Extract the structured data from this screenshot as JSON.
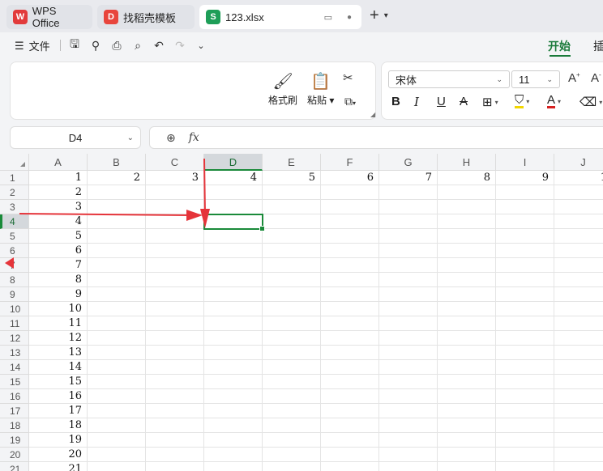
{
  "tabs": {
    "wps": {
      "label": "WPS Office",
      "icon": "W"
    },
    "daoke": {
      "label": "找稻壳模板",
      "icon": "D"
    },
    "file": {
      "label": "123.xlsx",
      "icon": "S"
    }
  },
  "menu": {
    "file_label": "文件",
    "ribbon_tab_active": "开始",
    "ribbon_tab_next": "插"
  },
  "ribbon": {
    "format_painter": "格式刷",
    "paste": "粘贴",
    "font_name": "宋体",
    "font_size": "11",
    "bold": "B",
    "italic": "I",
    "underline": "U",
    "strike": "A"
  },
  "formula_bar": {
    "cell_ref": "D4",
    "fx": "fx"
  },
  "colors": {
    "accent": "#1a8a3a",
    "arrow": "#e5343a"
  },
  "grid": {
    "columns": [
      "A",
      "B",
      "C",
      "D",
      "E",
      "F",
      "G",
      "H",
      "I",
      "J"
    ],
    "selected_column": "D",
    "rows": [
      "1",
      "2",
      "3",
      "4",
      "5",
      "6",
      "7",
      "8",
      "9",
      "10",
      "11",
      "12",
      "13",
      "14",
      "15",
      "16",
      "17",
      "18",
      "19",
      "20",
      "21"
    ],
    "selected_row": "4",
    "row1_values": [
      "1",
      "2",
      "3",
      "4",
      "5",
      "6",
      "7",
      "8",
      "9",
      "1"
    ],
    "colA_values": [
      "1",
      "2",
      "3",
      "4",
      "5",
      "6",
      "7",
      "8",
      "9",
      "10",
      "11",
      "12",
      "13",
      "14",
      "15",
      "16",
      "17",
      "18",
      "19",
      "20",
      "21"
    ]
  }
}
